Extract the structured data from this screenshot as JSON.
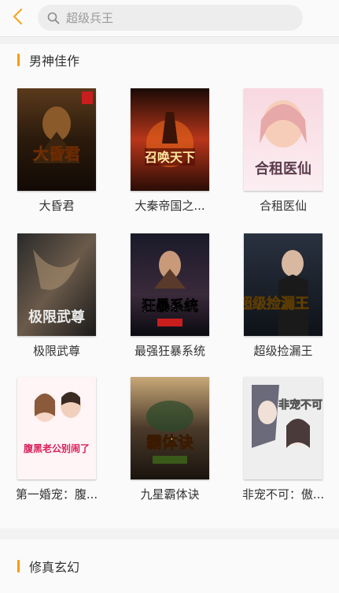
{
  "search": {
    "placeholder": "超级兵王"
  },
  "sections": [
    {
      "title": "男神佳作",
      "books": [
        {
          "title": "大昏君",
          "cover_text": "大昏君"
        },
        {
          "title": "大秦帝国之...",
          "cover_text": "召唤天下"
        },
        {
          "title": "合租医仙",
          "cover_text": "合租医仙"
        },
        {
          "title": "极限武尊",
          "cover_text": "极限武尊"
        },
        {
          "title": "最强狂暴系统",
          "cover_text": "狂暴系统"
        },
        {
          "title": "超级捡漏王",
          "cover_text": "超级捡漏王"
        },
        {
          "title": "第一婚宠：腹...",
          "cover_text": "腹黑老公别闹了"
        },
        {
          "title": "九星霸体诀",
          "cover_text": "霸体诀"
        },
        {
          "title": "非宠不可：傲...",
          "cover_text": "非宠不可"
        }
      ]
    },
    {
      "title": "修真玄幻"
    }
  ],
  "colors": {
    "accent": "#ff9900",
    "back_arrow": "#f5a623"
  }
}
